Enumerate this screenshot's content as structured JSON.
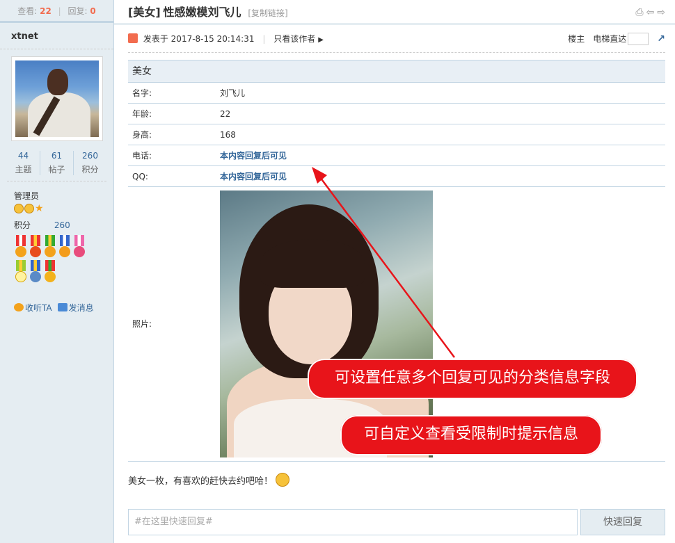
{
  "sidebar": {
    "views_label": "查看:",
    "views_count": "22",
    "replies_label": "回复:",
    "replies_count": "0",
    "author": "xtnet",
    "stats": [
      {
        "value": "44",
        "label": "主题"
      },
      {
        "value": "61",
        "label": "帖子"
      },
      {
        "value": "260",
        "label": "积分"
      }
    ],
    "role": "管理员",
    "credits_label": "积分",
    "credits_value": "260",
    "follow_label": "收听TA",
    "message_label": "发消息"
  },
  "thread": {
    "tag": "[美女]",
    "title": "性感嫩模刘飞儿",
    "copy_link": "[复制链接]"
  },
  "post_meta": {
    "posted_prefix": "发表于",
    "posted_at": "2017-8-15 20:14:31",
    "only_author": "只看该作者",
    "floor": "楼主",
    "jump_label": "电梯直达"
  },
  "info": {
    "category": "美女",
    "rows": [
      {
        "key": "名字:",
        "value": "刘飞儿"
      },
      {
        "key": "年龄:",
        "value": "22"
      },
      {
        "key": "身高:",
        "value": "168"
      },
      {
        "key": "电话:",
        "value": "本内容回复后可见"
      },
      {
        "key": "QQ:",
        "value": "本内容回复后可见"
      }
    ],
    "photo_key": "照片:"
  },
  "post_text": "美女一枚，有喜欢的赶快去约吧哈！",
  "quick_reply": {
    "placeholder": "#在这里快速回复#",
    "button": "快速回复"
  },
  "annotations": {
    "callout1": "可设置任意多个回复可见的分类信息字段",
    "callout2": "可自定义查看受限制时提示信息"
  },
  "colors": {
    "accent_red": "#e8141a",
    "link_blue": "#336699",
    "sidebar_bg": "#e5edf2"
  }
}
